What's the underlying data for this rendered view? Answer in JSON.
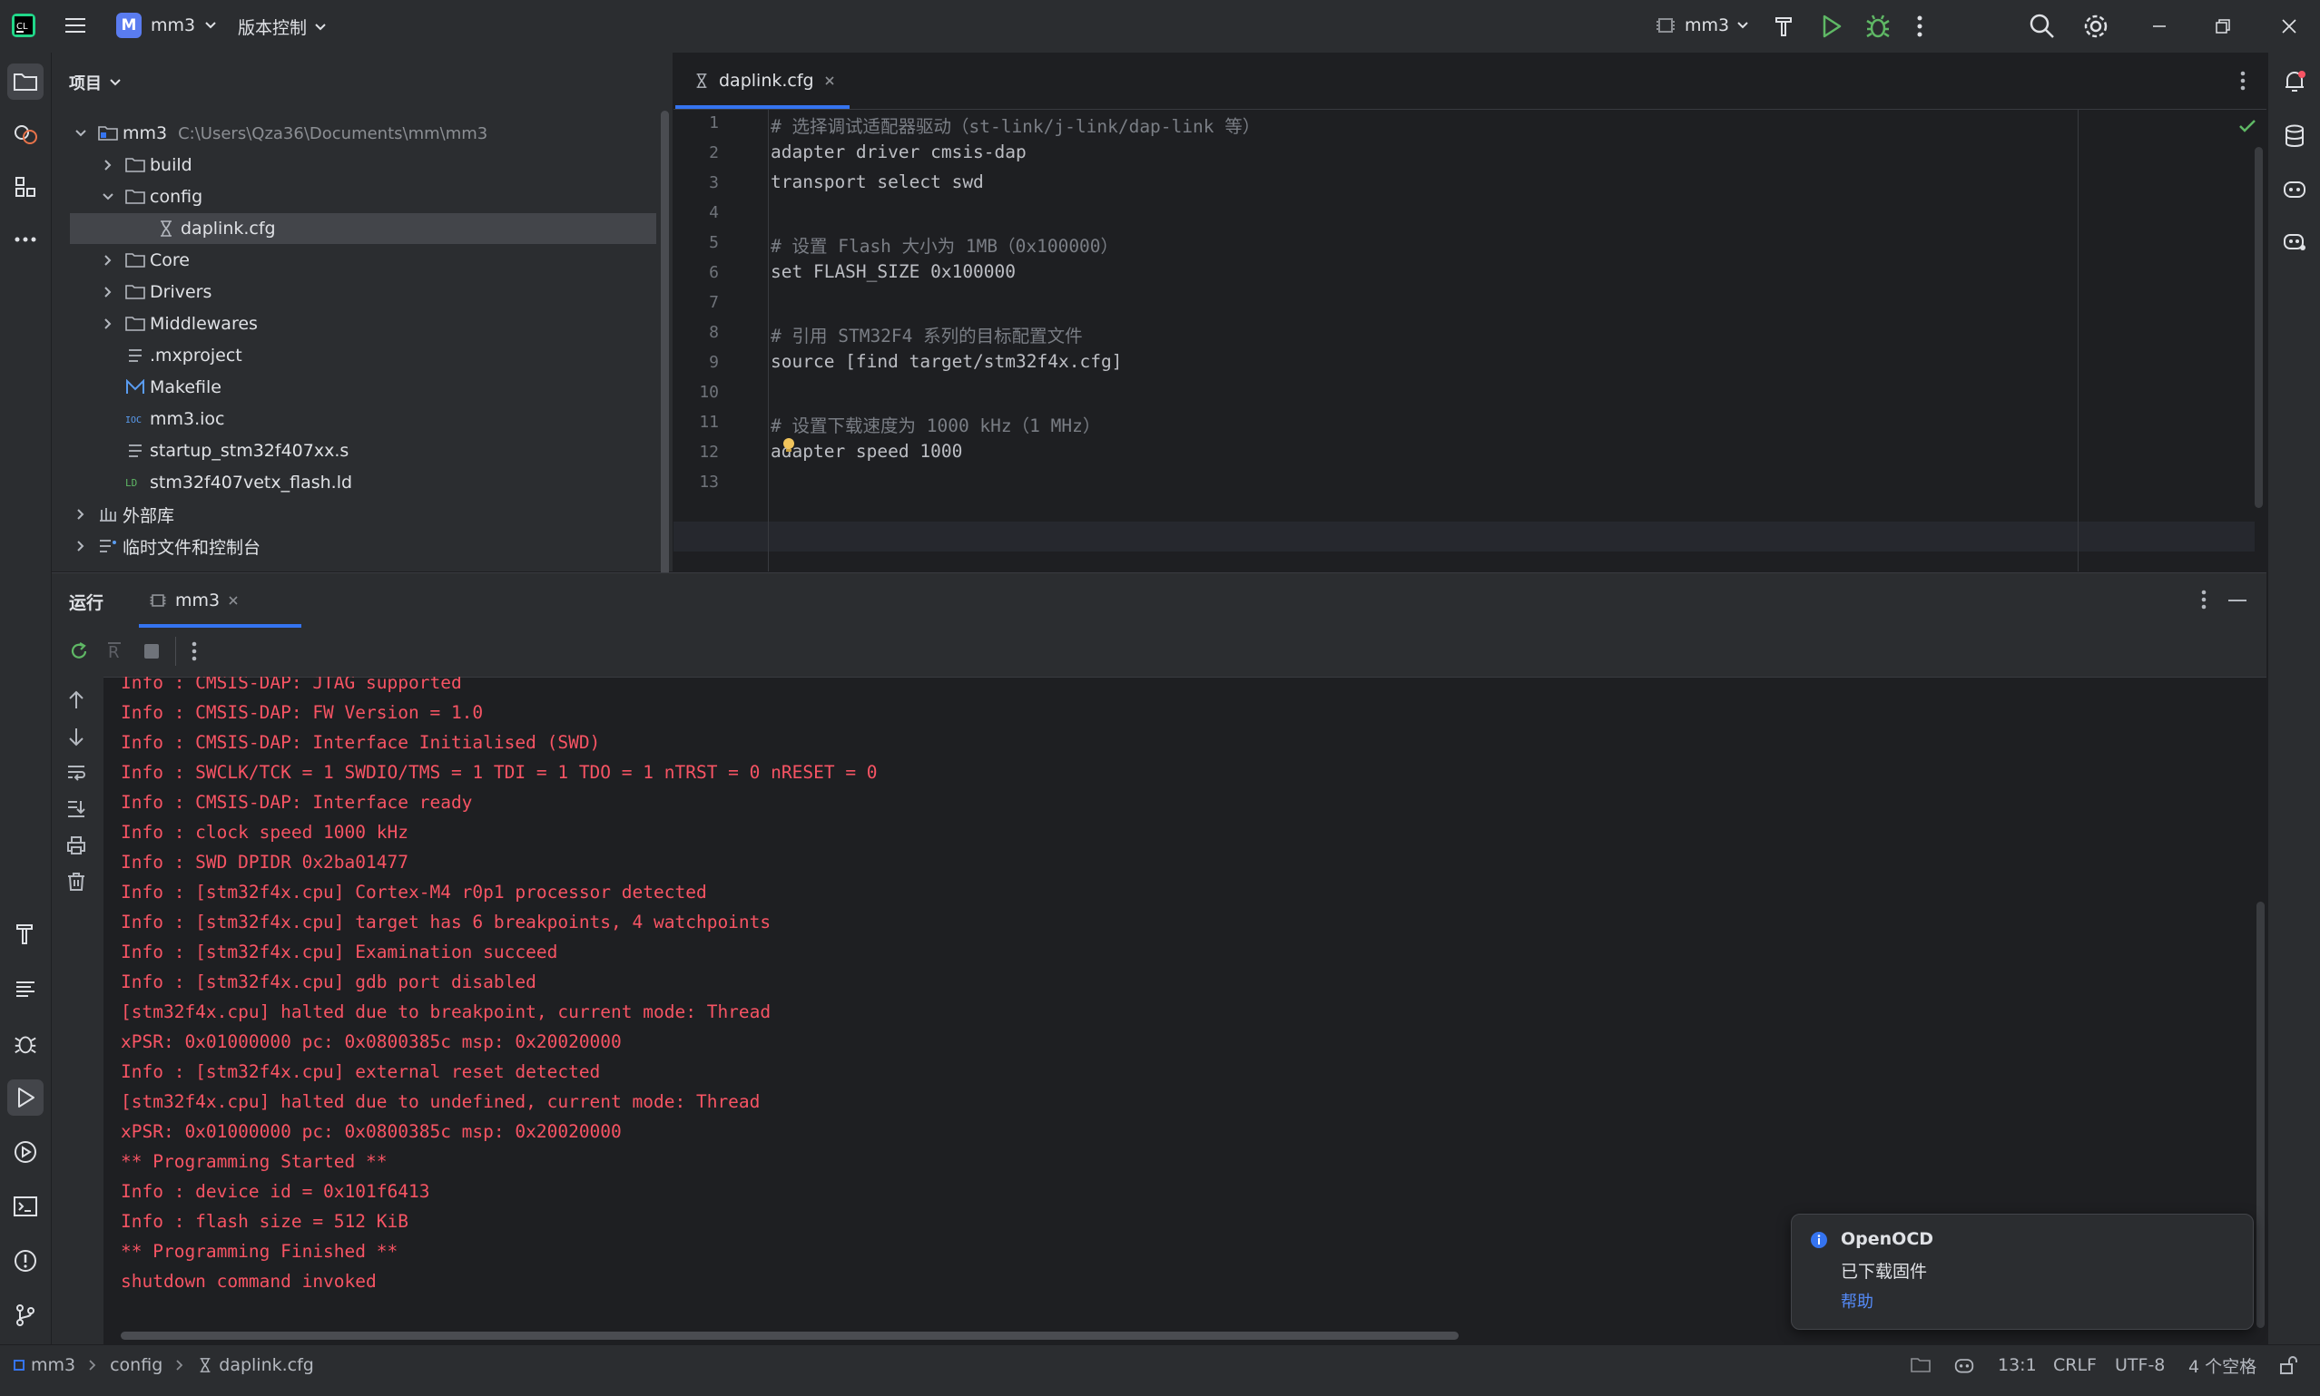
{
  "titlebar": {
    "project_badge": "M",
    "project_name": "mm3",
    "vcs_label": "版本控制",
    "run_config": "mm3"
  },
  "project_panel": {
    "title": "项目",
    "tree": [
      {
        "label": "mm3",
        "path": "C:\\Users\\Qza36\\Documents\\mm\\mm3"
      },
      {
        "label": "build"
      },
      {
        "label": "config"
      },
      {
        "label": "daplink.cfg"
      },
      {
        "label": "Core"
      },
      {
        "label": "Drivers"
      },
      {
        "label": "Middlewares"
      },
      {
        "label": ".mxproject"
      },
      {
        "label": "Makefile"
      },
      {
        "label": "mm3.ioc"
      },
      {
        "label": "startup_stm32f407xx.s"
      },
      {
        "label": "stm32f407vetx_flash.ld"
      },
      {
        "label": "外部库"
      },
      {
        "label": "临时文件和控制台"
      }
    ]
  },
  "editor": {
    "tab_label": "daplink.cfg",
    "line_numbers": [
      "1",
      "2",
      "3",
      "4",
      "5",
      "6",
      "7",
      "8",
      "9",
      "10",
      "11",
      "12",
      "13"
    ],
    "lines": [
      "# 选择调试适配器驱动（st-link/j-link/dap-link 等）",
      "adapter driver cmsis-dap",
      "transport select swd",
      "",
      "# 设置 Flash 大小为 1MB（0x100000）",
      "set FLASH_SIZE 0x100000",
      "",
      "# 引用 STM32F4 系列的目标配置文件",
      "source [find target/stm32f4x.cfg]",
      "",
      "# 设置下载速度为 1000 kHz（1 MHz）",
      "adapter speed 1000",
      ""
    ]
  },
  "run_panel": {
    "title": "运行",
    "tab_label": "mm3",
    "console": [
      "Info : CMSIS-DAP: JTAG supported",
      "Info : CMSIS-DAP: FW Version = 1.0",
      "Info : CMSIS-DAP: Interface Initialised (SWD)",
      "Info : SWCLK/TCK = 1 SWDIO/TMS = 1 TDI = 1 TDO = 1 nTRST = 0 nRESET = 0",
      "Info : CMSIS-DAP: Interface ready",
      "Info : clock speed 1000 kHz",
      "Info : SWD DPIDR 0x2ba01477",
      "Info : [stm32f4x.cpu] Cortex-M4 r0p1 processor detected",
      "Info : [stm32f4x.cpu] target has 6 breakpoints, 4 watchpoints",
      "Info : [stm32f4x.cpu] Examination succeed",
      "Info : [stm32f4x.cpu] gdb port disabled",
      "[stm32f4x.cpu] halted due to breakpoint, current mode: Thread",
      "xPSR: 0x01000000 pc: 0x0800385c msp: 0x20020000",
      "Info : [stm32f4x.cpu] external reset detected",
      "[stm32f4x.cpu] halted due to undefined, current mode: Thread",
      "xPSR: 0x01000000 pc: 0x0800385c msp: 0x20020000",
      "** Programming Started **",
      "Info : device id = 0x101f6413",
      "Info : flash size = 512 KiB",
      "** Programming Finished **",
      "shutdown command invoked"
    ]
  },
  "notification": {
    "title": "OpenOCD",
    "message": "已下载固件",
    "link": "帮助"
  },
  "statusbar": {
    "breadcrumb": [
      "mm3",
      "config",
      "daplink.cfg"
    ],
    "position": "13:1",
    "line_ending": "CRLF",
    "encoding": "UTF-8",
    "indent": "4 个空格"
  },
  "colors": {
    "accent": "#3574f0",
    "console_text": "#f75464",
    "run_green": "#5fb865",
    "debug_green": "#5fb865"
  }
}
